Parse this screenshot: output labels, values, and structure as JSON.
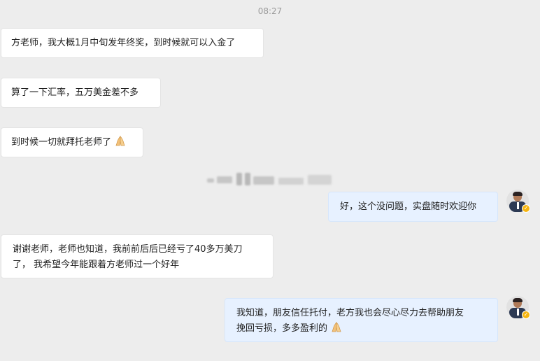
{
  "chat": {
    "timestamp": "08:27",
    "messages": [
      {
        "side": "left",
        "text": "方老师，我大概1月中旬发年终奖，到时候就可以入金了"
      },
      {
        "side": "left",
        "text": "算了一下汇率，五万美金差不多"
      },
      {
        "side": "left",
        "text": "到时候一切就拜托老师了",
        "emoji": "praying-hands-icon"
      },
      {
        "side": "right",
        "text": "好，这个没问题，实盘随时欢迎你"
      },
      {
        "side": "left",
        "line1": "谢谢老师，老师也知道，我前前后后已经亏了40多万美刀",
        "line2": "了， 我希望今年能跟着方老师过一个好年"
      },
      {
        "side": "right",
        "line1": "我知道，朋友信任托付，老方我也会尽心尽力去帮助朋友",
        "line2": "挽回亏损，多多盈利的",
        "emoji": "praying-hands-icon"
      }
    ]
  },
  "colors": {
    "background": "#ededed",
    "left_bubble": "#ffffff",
    "right_bubble": "#e7f1ff",
    "badge": "#f6b511"
  }
}
